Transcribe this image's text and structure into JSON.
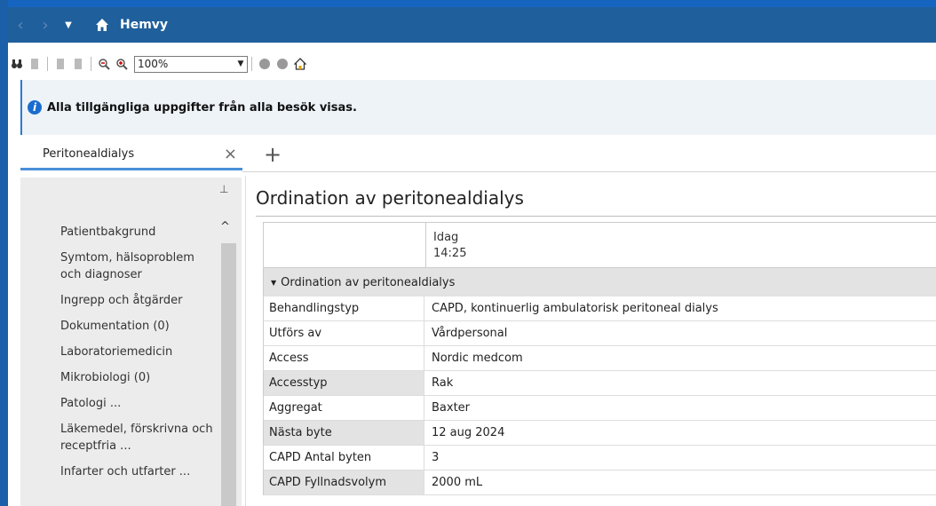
{
  "nav": {
    "back": "‹",
    "forward": "›",
    "title": "Hemvy"
  },
  "toolbar": {
    "zoom": "100%"
  },
  "info": {
    "text": "Alla tillgängliga uppgifter från alla besök visas."
  },
  "tabs": [
    {
      "label": "Peritonealdialys",
      "close": "×"
    }
  ],
  "addtab": "+",
  "sidebar": {
    "items": [
      "Patientbakgrund",
      "Symtom, hälsoproblem och diagnoser",
      "Ingrepp och åtgärder",
      "Dokumentation (0)",
      "Laboratoriemedicin",
      "Mikrobiologi (0)",
      "Patologi ...",
      "Läkemedel, förskrivna och receptfria ...",
      "Infarter och utfarter ..."
    ]
  },
  "main": {
    "title": "Ordination av peritonealdialys",
    "col_header_1": "Idag",
    "col_header_2": "14:25",
    "group": "Ordination av peritonealdialys",
    "rows": [
      {
        "k": "Behandlingstyp",
        "v": "CAPD, kontinuerlig ambulatorisk peritoneal dialys"
      },
      {
        "k": "Utförs av",
        "v": "Vårdpersonal"
      },
      {
        "k": "Access",
        "v": "Nordic medcom"
      },
      {
        "k": "Accesstyp",
        "v": "Rak"
      },
      {
        "k": "Aggregat",
        "v": "Baxter"
      },
      {
        "k": "Nästa byte",
        "v": "12 aug 2024"
      },
      {
        "k": "CAPD Antal byten",
        "v": "3"
      },
      {
        "k": "CAPD Fyllnadsvolym",
        "v": "2000 mL"
      }
    ]
  }
}
